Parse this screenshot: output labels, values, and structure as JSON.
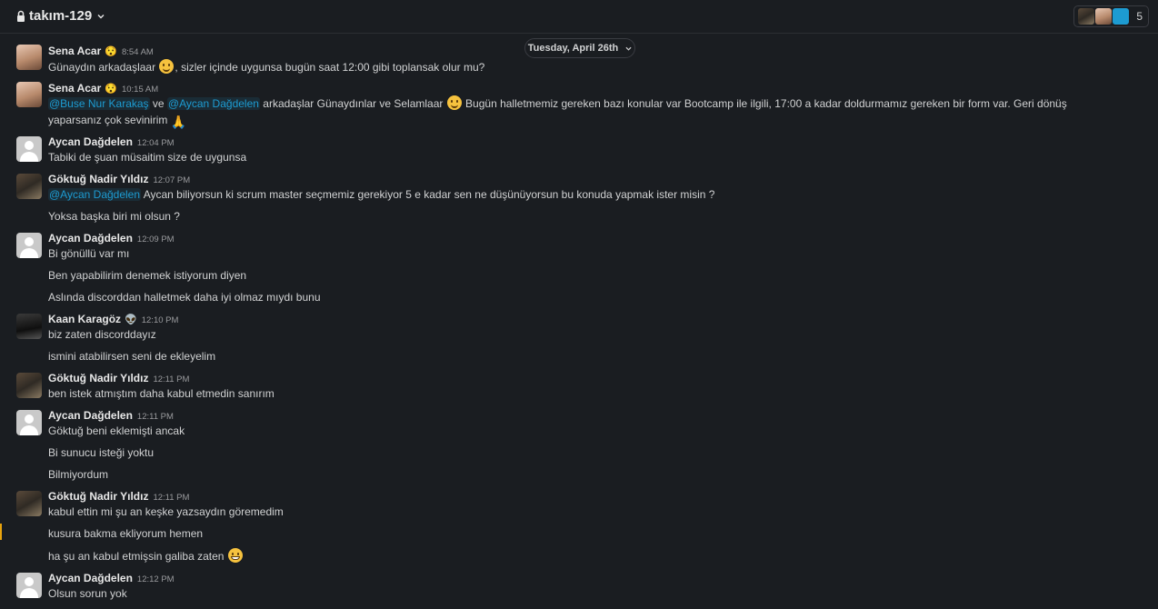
{
  "header": {
    "channel_name": "takım-129",
    "member_count": "5"
  },
  "date_divider": {
    "label": "Tuesday, April 26th"
  },
  "messages": [
    {
      "author": "Sena Acar",
      "status": "😯",
      "time": "8:54 AM",
      "t1": "Günaydın arkadaşlaar ",
      "t2": ", sizler içinde uygunsa bugün saat 12:00 gibi toplansak olur mu?"
    },
    {
      "author": "Sena Acar",
      "status": "😯",
      "time": "10:15 AM",
      "mention1": "@Buse Nur Karakaş",
      "t1": " ve ",
      "mention2": "@Aycan Dağdelen",
      "t2": " arkadaşlar Günaydınlar ve Selamlaar ",
      "t3": " Bugün halletmemiz gereken bazı konular var Bootcamp ile ilgili, 17:00 a kadar doldurmamız gereken bir form var. Geri dönüş yaparsanız çok sevinirim "
    },
    {
      "author": "Aycan Dağdelen",
      "time": "12:04 PM",
      "t1": "Tabiki de şuan müsaitim size de uygunsa"
    },
    {
      "author": "Göktuğ Nadir Yıldız",
      "time": "12:07 PM",
      "mention1": "@Aycan Dağdelen",
      "t1": " Aycan biliyorsun ki scrum master seçmemiz gerekiyor 5 e kadar sen ne düşünüyorsun bu konuda yapmak ister misin ?",
      "t2": "Yoksa başka biri mi olsun ?"
    },
    {
      "author": "Aycan Dağdelen",
      "time": "12:09 PM",
      "t1": "Bi gönüllü var mı",
      "t2": "Ben yapabilirim denemek istiyorum diyen",
      "t3": "Aslında discorddan halletmek daha iyi olmaz mıydı bunu"
    },
    {
      "author": "Kaan Karagöz",
      "status": "👽",
      "time": "12:10 PM",
      "t1": "biz zaten discorddayız",
      "t2": "ismini atabilirsen seni de ekleyelim"
    },
    {
      "author": "Göktuğ Nadir Yıldız",
      "time": "12:11 PM",
      "t1": "ben istek atmıştım daha kabul etmedin sanırım"
    },
    {
      "author": "Aycan Dağdelen",
      "time": "12:11 PM",
      "t1": "Göktuğ beni eklemişti ancak",
      "t2": "Bi sunucu isteği yoktu",
      "t3": "Bilmiyordum"
    },
    {
      "author": "Göktuğ Nadir Yıldız",
      "time": "12:11 PM",
      "t1": "kabul ettin mi şu an keşke yazsaydın göremedim",
      "t2": "kusura bakma ekliyorum hemen",
      "t3": "ha şu an kabul etmişsin galiba zaten "
    },
    {
      "author": "Aycan Dağdelen",
      "time": "12:12 PM",
      "t1": "Olsun sorun yok"
    }
  ],
  "emojis": {
    "smile": "smiling-face",
    "grin": "grinning-face",
    "pray": "🙏"
  }
}
